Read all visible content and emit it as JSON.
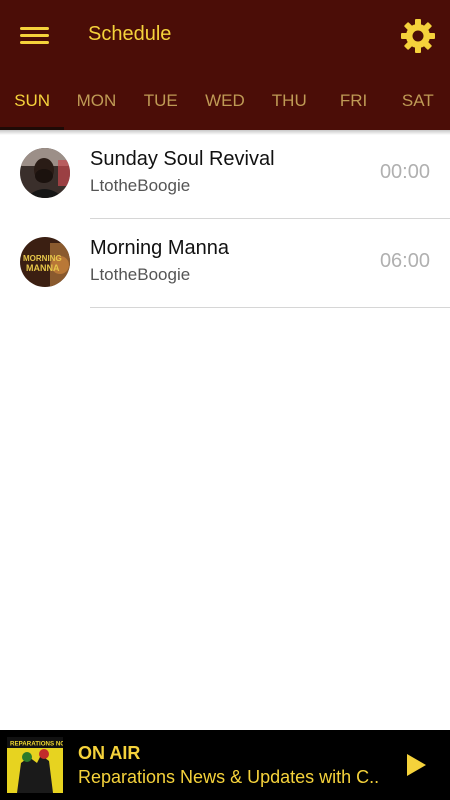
{
  "header": {
    "title": "Schedule",
    "menu_icon": "hamburger-menu-icon",
    "settings_icon": "gear-icon"
  },
  "tabs": [
    {
      "label": "SUN",
      "active": true
    },
    {
      "label": "MON",
      "active": false
    },
    {
      "label": "TUE",
      "active": false
    },
    {
      "label": "WED",
      "active": false
    },
    {
      "label": "THU",
      "active": false
    },
    {
      "label": "FRI",
      "active": false
    },
    {
      "label": "SAT",
      "active": false
    }
  ],
  "schedule": [
    {
      "show": "Sunday Soul Revival",
      "host": "LtotheBoogie",
      "time": "00:00"
    },
    {
      "show": "Morning Manna",
      "host": "LtotheBoogie",
      "time": "06:00",
      "art_text": "MORNING MANNA"
    }
  ],
  "player": {
    "status": "ON AIR",
    "now_playing": "Reparations News & Updates with C..",
    "cover_text": "REPARATIONS NOW!",
    "play_icon": "play-icon"
  },
  "colors": {
    "bar_bg": "#4b0d07",
    "accent": "#f5d23b",
    "tab_inactive": "#bf9a55",
    "player_bg": "#000000"
  }
}
